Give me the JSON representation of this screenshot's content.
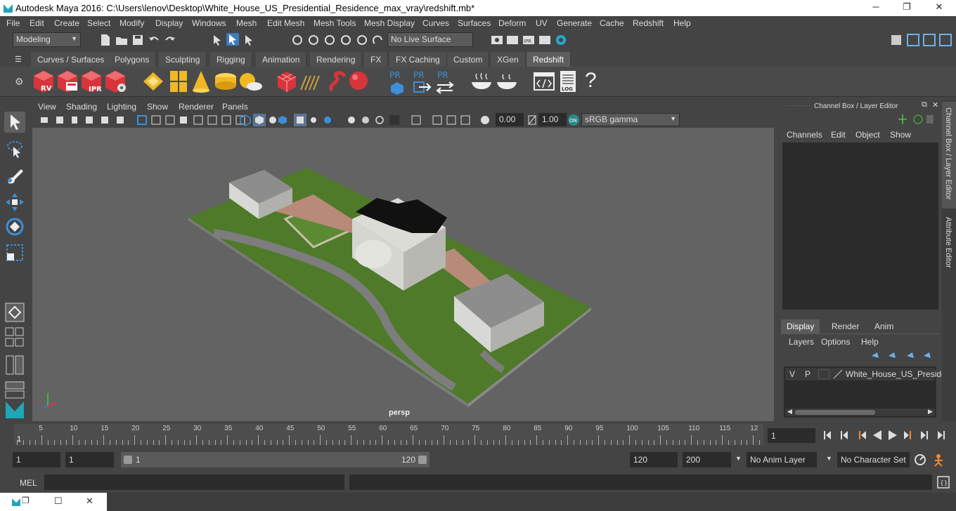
{
  "window": {
    "title": "Autodesk Maya 2016: C:\\Users\\lenov\\Desktop\\White_House_US_Presidential_Residence_max_vray\\redshift.mb*",
    "minimize": "─",
    "maximize": "❐",
    "close": "✕"
  },
  "menu": [
    "File",
    "Edit",
    "Create",
    "Select",
    "Modify",
    "Display",
    "Windows",
    "Mesh",
    "Edit Mesh",
    "Mesh Tools",
    "Mesh Display",
    "Curves",
    "Surfaces",
    "Deform",
    "UV",
    "Generate",
    "Cache",
    "Redshift",
    "Help"
  ],
  "status": {
    "mode": "Modeling",
    "live_surface": "No Live Surface"
  },
  "shelf_tabs": [
    "Curves / Surfaces",
    "Polygons",
    "Sculpting",
    "Rigging",
    "Animation",
    "Rendering",
    "FX",
    "FX Caching",
    "Custom",
    "XGen",
    "Redshift"
  ],
  "shelf_active": "Redshift",
  "shelf_labels": {
    "rv": "RV",
    "ipr": "IPR",
    "pr": "PR",
    "log": "LOG",
    "help": "?"
  },
  "viewport": {
    "menu": [
      "View",
      "Shading",
      "Lighting",
      "Show",
      "Renderer",
      "Panels"
    ],
    "exposure": "0.00",
    "gamma": "1.00",
    "colorspace": "sRGB gamma",
    "camera": "persp"
  },
  "channel_box": {
    "title": "Channel Box / Layer Editor",
    "menu": [
      "Channels",
      "Edit",
      "Object",
      "Show"
    ]
  },
  "layer_editor": {
    "tabs": [
      "Display",
      "Render",
      "Anim"
    ],
    "active_tab": "Display",
    "menu": [
      "Layers",
      "Options",
      "Help"
    ],
    "layer": {
      "v": "V",
      "p": "P",
      "name": "White_House_US_Preside"
    }
  },
  "side_tabs": [
    "Channel Box / Layer Editor",
    "Attribute Editor"
  ],
  "timeline": {
    "ticks": [
      5,
      10,
      15,
      20,
      25,
      30,
      35,
      40,
      45,
      50,
      55,
      60,
      65,
      70,
      75,
      80,
      85,
      90,
      95,
      100,
      105,
      110,
      115,
      "12"
    ],
    "start_marker": "1",
    "current_frame": "1"
  },
  "range": {
    "start": "1",
    "playback_start": "1",
    "slider_start": "1",
    "slider_end": "120",
    "playback_end": "120",
    "end": "200",
    "anim_layer": "No Anim Layer",
    "character_set": "No Character Set"
  },
  "command": {
    "label": "MEL"
  },
  "taskbar": {
    "restore": "❐",
    "maximize": "☐",
    "close": "✕"
  },
  "colors": {
    "grass": "#4e7a2a",
    "panel": "#444444",
    "canvas": "#636363",
    "redshift_red": "#d8343b",
    "accent_blue": "#3c8fd8"
  }
}
